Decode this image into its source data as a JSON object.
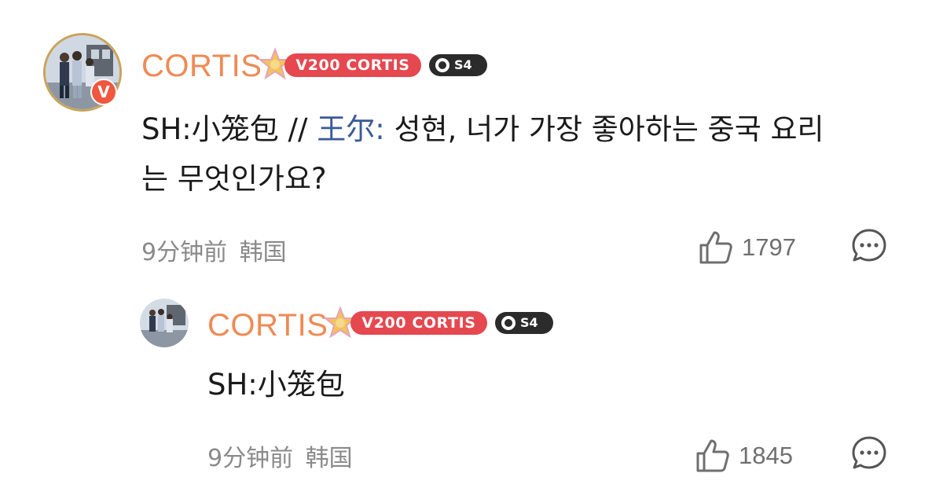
{
  "colors": {
    "username": "#ef8a55",
    "vip_badge": "#e5484f",
    "level_badge": "#2b2b2b",
    "mention": "#3a5a99",
    "meta": "#8a8a8a",
    "text": "#1a1a1a"
  },
  "comment": {
    "username": "CORTIS",
    "vip_badge": "V200 CORTIS",
    "level_badge": "S4",
    "verified_badge": "V",
    "text_prefix": "SH:小笼包 // ",
    "mention": "王尔:",
    "text_line1_rest": " 성현, 너가 가장 좋아하는 중국 요리",
    "text_line2": "는 무엇인가요?",
    "time": "9分钟前",
    "location": "韩国",
    "likes": "1797",
    "icons": [
      "star-badge-icon",
      "thumbs-up-icon",
      "comment-bubble-icon",
      "verified-v-icon"
    ]
  },
  "reply": {
    "username": "CORTIS",
    "vip_badge": "V200 CORTIS",
    "level_badge": "S4",
    "text": "SH:小笼包",
    "time": "9分钟前",
    "location": "韩国",
    "likes": "1845"
  }
}
